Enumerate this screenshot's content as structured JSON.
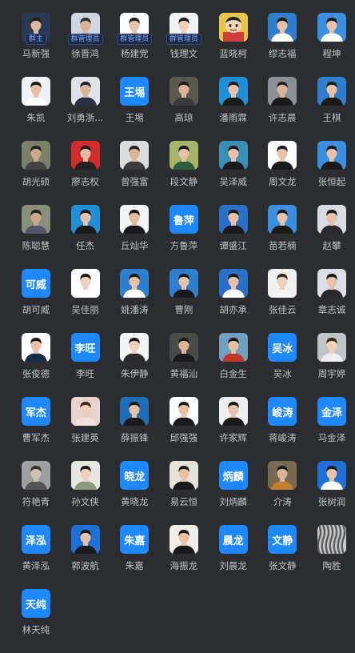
{
  "colors": {
    "background": "#2b2d31",
    "name_text": "#bfc2c7",
    "text_avatar_bg": "#1e88ff",
    "badge_text": "#7fa8ff"
  },
  "members": [
    {
      "name": "马新强",
      "badge": "群主",
      "avatar": {
        "kind": "photo",
        "bg": "#2a3a55",
        "skin": "#e0b8a0",
        "hair": "#222",
        "shirt": "#1a3b7a"
      }
    },
    {
      "name": "徐晋鸿",
      "badge": "群管理员",
      "avatar": {
        "kind": "photo",
        "bg": "#cfd6df",
        "skin": "#d9b49a",
        "hair": "#333",
        "shirt": "#3a4e6e"
      }
    },
    {
      "name": "杨建党",
      "badge": "群管理员",
      "avatar": {
        "kind": "photo",
        "bg": "#ffffff",
        "skin": "#e6c4ae",
        "hair": "#222",
        "shirt": "#1b2f5a"
      }
    },
    {
      "name": "钱理文",
      "badge": "群管理员",
      "avatar": {
        "kind": "photo",
        "bg": "#f2f2f2",
        "skin": "#f0d0bd",
        "hair": "#1a1a1a",
        "shirt": "#e8e8e8"
      }
    },
    {
      "name": "蓝晓柯",
      "badge": "",
      "avatar": {
        "kind": "cartoon",
        "bg": "#e9c54a",
        "skin": "#f3d5b5",
        "hair": "#222",
        "shirt": "#d23c3c"
      }
    },
    {
      "name": "缪志福",
      "badge": "",
      "avatar": {
        "kind": "photo",
        "bg": "#2f7fd1",
        "skin": "#e7c2a6",
        "hair": "#1a1a1a",
        "shirt": "#ffffff"
      }
    },
    {
      "name": "程坤",
      "badge": "",
      "avatar": {
        "kind": "photo",
        "bg": "#3a8fe0",
        "skin": "#e7c2a6",
        "hair": "#1a1a1a",
        "shirt": "#ffffff"
      }
    },
    {
      "name": "朱凯",
      "badge": "",
      "avatar": {
        "kind": "photo",
        "bg": "#eef2f6",
        "skin": "#e7c2a6",
        "hair": "#1a1a1a",
        "shirt": "#ffffff"
      }
    },
    {
      "name": "刘勇浙...",
      "badge": "",
      "avatar": {
        "kind": "photo",
        "bg": "#dfe3e8",
        "skin": "#d9b49a",
        "hair": "#222",
        "shirt": "#2a3242"
      }
    },
    {
      "name": "王埸",
      "badge": "",
      "avatar": {
        "kind": "text",
        "text": "王埸"
      }
    },
    {
      "name": "高琼",
      "badge": "",
      "avatar": {
        "kind": "photo",
        "bg": "#5c5a4e",
        "skin": "#d9b49a",
        "hair": "#1a1a1a",
        "shirt": "#3a3a3a"
      }
    },
    {
      "name": "潘雨霖",
      "badge": "",
      "avatar": {
        "kind": "photo",
        "bg": "#1f8fd6",
        "skin": "#e7c2a6",
        "hair": "#1a1a1a",
        "shirt": "#1a1a1a"
      }
    },
    {
      "name": "许志晨",
      "badge": "",
      "avatar": {
        "kind": "photo",
        "bg": "#8a9098",
        "skin": "#d9b49a",
        "hair": "#222",
        "shirt": "#1a1a1a"
      }
    },
    {
      "name": "王棋",
      "badge": "",
      "avatar": {
        "kind": "photo",
        "bg": "#2f7fd1",
        "skin": "#e7c2a6",
        "hair": "#1a1a1a",
        "shirt": "#1a1a1a"
      }
    },
    {
      "name": "胡光硕",
      "badge": "",
      "avatar": {
        "kind": "photo",
        "bg": "#7b8068",
        "skin": "#c9a88e",
        "hair": "#222",
        "shirt": "#444"
      }
    },
    {
      "name": "廖志权",
      "badge": "",
      "avatar": {
        "kind": "photo",
        "bg": "#d42b2b",
        "skin": "#e2bda3",
        "hair": "#1a1a1a",
        "shirt": "#222"
      }
    },
    {
      "name": "曾强富",
      "badge": "",
      "avatar": {
        "kind": "photo",
        "bg": "#dcdcdc",
        "skin": "#d9b49a",
        "hair": "#222",
        "shirt": "#3b3b3b"
      }
    },
    {
      "name": "段文静",
      "badge": "",
      "avatar": {
        "kind": "photo",
        "bg": "#a8b46a",
        "skin": "#e7c2a6",
        "hair": "#1a1a1a",
        "shirt": "#2e5d3a"
      }
    },
    {
      "name": "吴泽威",
      "badge": "",
      "avatar": {
        "kind": "photo",
        "bg": "#3a8fb8",
        "skin": "#e7c2a6",
        "hair": "#1a1a1a",
        "shirt": "#1a1a1a"
      }
    },
    {
      "name": "周文龙",
      "badge": "",
      "avatar": {
        "kind": "photo",
        "bg": "#ffffff",
        "skin": "#e7c2a6",
        "hair": "#1a1a1a",
        "shirt": "#1a1a1a"
      }
    },
    {
      "name": "张恒起",
      "badge": "",
      "avatar": {
        "kind": "photo",
        "bg": "#3a8fe0",
        "skin": "#e7c2a6",
        "hair": "#1a1a1a",
        "shirt": "#1a1a1a"
      }
    },
    {
      "name": "陈聪慧",
      "badge": "",
      "avatar": {
        "kind": "photo",
        "bg": "#8a8f7a",
        "skin": "#c9a88e",
        "hair": "#222",
        "shirt": "#556"
      }
    },
    {
      "name": "任杰",
      "badge": "",
      "avatar": {
        "kind": "photo",
        "bg": "#1f8fd6",
        "skin": "#e7c2a6",
        "hair": "#1a1a1a",
        "shirt": "#1a1a1a"
      }
    },
    {
      "name": "丘灿华",
      "badge": "",
      "avatar": {
        "kind": "photo",
        "bg": "#f4f4f4",
        "skin": "#e2bda3",
        "hair": "#1a1a1a",
        "shirt": "#1a1a1a"
      }
    },
    {
      "name": "方鲁萍",
      "badge": "",
      "avatar": {
        "kind": "text",
        "text": "鲁萍"
      }
    },
    {
      "name": "谭盛江",
      "badge": "",
      "avatar": {
        "kind": "photo",
        "bg": "#2a6fc8",
        "skin": "#e7c2a6",
        "hair": "#1a1a1a",
        "shirt": "#1a1a1a"
      }
    },
    {
      "name": "苗若楠",
      "badge": "",
      "avatar": {
        "kind": "photo",
        "bg": "#3a8fe0",
        "skin": "#e7c2a6",
        "hair": "#1a1a1a",
        "shirt": "#1a1a1a"
      }
    },
    {
      "name": "赵攀",
      "badge": "",
      "avatar": {
        "kind": "photo",
        "bg": "#d8dbe0",
        "skin": "#e7c2a6",
        "hair": "#1a1a1a",
        "shirt": "#2a2a2a"
      }
    },
    {
      "name": "胡可威",
      "badge": "",
      "avatar": {
        "kind": "text",
        "text": "可威"
      }
    },
    {
      "name": "吴佳丽",
      "badge": "",
      "avatar": {
        "kind": "photo",
        "bg": "#ffffff",
        "skin": "#f0d0bd",
        "hair": "#1a1a1a",
        "shirt": "#ffffff"
      }
    },
    {
      "name": "姚潘涛",
      "badge": "",
      "avatar": {
        "kind": "photo",
        "bg": "#2f7fd1",
        "skin": "#e7c2a6",
        "hair": "#1a1a1a",
        "shirt": "#ffffff"
      }
    },
    {
      "name": "曹刚",
      "badge": "",
      "avatar": {
        "kind": "photo",
        "bg": "#2f7fd1",
        "skin": "#e7c2a6",
        "hair": "#1a1a1a",
        "shirt": "#1a1a1a"
      }
    },
    {
      "name": "胡亦承",
      "badge": "",
      "avatar": {
        "kind": "photo",
        "bg": "#2a6fc8",
        "skin": "#e7c2a6",
        "hair": "#1a1a1a",
        "shirt": "#ffffff"
      }
    },
    {
      "name": "张佳云",
      "badge": "",
      "avatar": {
        "kind": "photo",
        "bg": "#f0f0f0",
        "skin": "#f0d0bd",
        "hair": "#3a2a1a",
        "shirt": "#f5f5f5"
      }
    },
    {
      "name": "章志诚",
      "badge": "",
      "avatar": {
        "kind": "photo",
        "bg": "#dcdfe6",
        "skin": "#e7c2a6",
        "hair": "#1a1a1a",
        "shirt": "#2a2a2a"
      }
    },
    {
      "name": "张俊德",
      "badge": "",
      "avatar": {
        "kind": "photo",
        "bg": "#ffffff",
        "skin": "#e7c2a6",
        "hair": "#1a1a1a",
        "shirt": "#1a2a4a"
      }
    },
    {
      "name": "李旺",
      "badge": "",
      "avatar": {
        "kind": "text",
        "text": "李旺"
      }
    },
    {
      "name": "朱伊静",
      "badge": "",
      "avatar": {
        "kind": "photo",
        "bg": "#f4f4f4",
        "skin": "#f0d0bd",
        "hair": "#1a1a1a",
        "shirt": "#2a2a2a"
      }
    },
    {
      "name": "黄福汕",
      "badge": "",
      "avatar": {
        "kind": "photo",
        "bg": "#4a4a48",
        "skin": "#d9b49a",
        "hair": "#1a1a1a",
        "shirt": "#1a1a1a"
      }
    },
    {
      "name": "白金生",
      "badge": "",
      "avatar": {
        "kind": "photo",
        "bg": "#6fa0c0",
        "skin": "#e7c2a6",
        "hair": "#1a1a1a",
        "shirt": "#c0392b"
      }
    },
    {
      "name": "吴冰",
      "badge": "",
      "avatar": {
        "kind": "text",
        "text": "吴冰"
      }
    },
    {
      "name": "周宇婷",
      "badge": "",
      "avatar": {
        "kind": "photo",
        "bg": "#bfc4c8",
        "skin": "#f0d0bd",
        "hair": "#3a2a1a",
        "shirt": "#eeeeee"
      }
    },
    {
      "name": "曹军杰",
      "badge": "",
      "avatar": {
        "kind": "text",
        "text": "军杰"
      }
    },
    {
      "name": "张建英",
      "badge": "",
      "avatar": {
        "kind": "photo",
        "bg": "#e8d3cf",
        "skin": "#f0d0bd",
        "hair": "#3a2a1a",
        "shirt": "#f1e1dd"
      }
    },
    {
      "name": "薛振锋",
      "badge": "",
      "avatar": {
        "kind": "photo",
        "bg": "#1f6fb8",
        "skin": "#e7c2a6",
        "hair": "#1a1a1a",
        "shirt": "#1a1a1a"
      }
    },
    {
      "name": "邱强强",
      "badge": "",
      "avatar": {
        "kind": "photo",
        "bg": "#ffffff",
        "skin": "#e7c2a6",
        "hair": "#1a1a1a",
        "shirt": "#1a1a1a"
      }
    },
    {
      "name": "许家辉",
      "badge": "",
      "avatar": {
        "kind": "photo",
        "bg": "#eeeeee",
        "skin": "#e7c2a6",
        "hair": "#1a1a1a",
        "shirt": "#1a1a1a"
      }
    },
    {
      "name": "蒋峻涛",
      "badge": "",
      "avatar": {
        "kind": "text",
        "text": "峻涛"
      }
    },
    {
      "name": "马金泽",
      "badge": "",
      "avatar": {
        "kind": "text",
        "text": "金泽"
      }
    },
    {
      "name": "符艳青",
      "badge": "",
      "avatar": {
        "kind": "photo",
        "bg": "#a0a0a0",
        "skin": "#d0c0b0",
        "hair": "#333",
        "shirt": "#555"
      }
    },
    {
      "name": "孙文侠",
      "badge": "",
      "avatar": {
        "kind": "photo",
        "bg": "#e8e6e0",
        "skin": "#f0d0bd",
        "hair": "#1a1a1a",
        "shirt": "#8a9a7a"
      }
    },
    {
      "name": "黄晓龙",
      "badge": "",
      "avatar": {
        "kind": "text",
        "text": "晓龙"
      }
    },
    {
      "name": "易云恒",
      "badge": "",
      "avatar": {
        "kind": "photo",
        "bg": "#e6e2da",
        "skin": "#e7c2a6",
        "hair": "#1a1a1a",
        "shirt": "#1a1a1a"
      }
    },
    {
      "name": "刘炳麟",
      "badge": "",
      "avatar": {
        "kind": "text",
        "text": "炳麟"
      }
    },
    {
      "name": "介涛",
      "badge": "",
      "avatar": {
        "kind": "photo",
        "bg": "#7a6a50",
        "skin": "#d9b49a",
        "hair": "#1a1a1a",
        "shirt": "#c08030"
      }
    },
    {
      "name": "张树润",
      "badge": "",
      "avatar": {
        "kind": "photo",
        "bg": "#1f6fd8",
        "skin": "#e7c2a6",
        "hair": "#1a1a1a",
        "shirt": "#ffffff"
      }
    },
    {
      "name": "黄泽泓",
      "badge": "",
      "avatar": {
        "kind": "text",
        "text": "泽泓"
      }
    },
    {
      "name": "郭波航",
      "badge": "",
      "avatar": {
        "kind": "photo",
        "bg": "#1f6fd8",
        "skin": "#e7c2a6",
        "hair": "#1a1a1a",
        "shirt": "#1a1a1a"
      }
    },
    {
      "name": "朱嘉",
      "badge": "",
      "avatar": {
        "kind": "text",
        "text": "朱嘉"
      }
    },
    {
      "name": "海振龙",
      "badge": "",
      "avatar": {
        "kind": "photo",
        "bg": "#f0ede6",
        "skin": "#e7c2a6",
        "hair": "#1a1a1a",
        "shirt": "#1a1a1a"
      }
    },
    {
      "name": "刘晨龙",
      "badge": "",
      "avatar": {
        "kind": "text",
        "text": "晨龙"
      }
    },
    {
      "name": "张文静",
      "badge": "",
      "avatar": {
        "kind": "text",
        "text": "文静"
      }
    },
    {
      "name": "陶胜",
      "badge": "",
      "avatar": {
        "kind": "pattern",
        "bg": "#c8c8c8",
        "fg": "#5a5a5a"
      }
    },
    {
      "name": "林天纯",
      "badge": "",
      "avatar": {
        "kind": "text",
        "text": "天纯"
      }
    }
  ]
}
